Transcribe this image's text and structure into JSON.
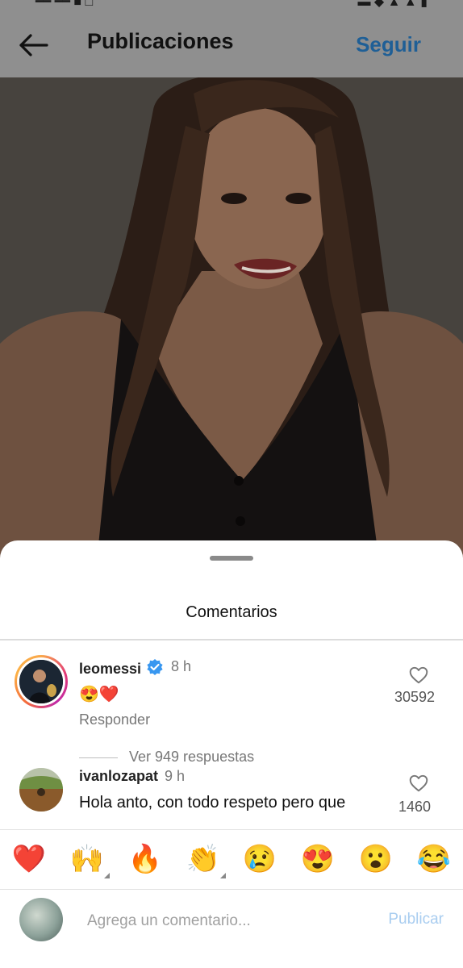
{
  "header": {
    "title": "Publicaciones",
    "follow_label": "Seguir",
    "back_icon": "arrow-left-icon"
  },
  "sheet": {
    "title": "Comentarios"
  },
  "comments": [
    {
      "username": "leomessi",
      "verified": true,
      "time": "8 h",
      "text": "😍❤️",
      "reply_label": "Responder",
      "likes": "30592",
      "view_replies": "Ver 949 respuestas"
    },
    {
      "username": "ivanlozapat",
      "verified": false,
      "time": "9 h",
      "text": "Hola anto, con todo respeto pero que",
      "likes": "1460"
    }
  ],
  "emoji_bar": [
    "❤️",
    "🙌",
    "🔥",
    "👏",
    "😢",
    "😍",
    "😮",
    "😂"
  ],
  "composer": {
    "placeholder": "Agrega un comentario...",
    "publish_label": "Publicar"
  },
  "colors": {
    "accent_follow": "#1f5f96",
    "publish_disabled": "#a9cdf0",
    "verified_blue": "#3897f0",
    "overlay_gray": "#8f8f8f"
  }
}
